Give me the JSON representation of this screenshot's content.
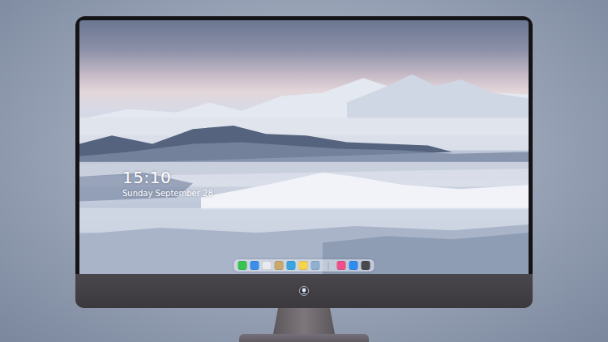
{
  "lock_screen": {
    "time": "15:10",
    "date": "Sunday September 28"
  },
  "dock": {
    "items": [
      {
        "kind": "app",
        "color": "#3ac44f"
      },
      {
        "kind": "app",
        "color": "#3b8fe8"
      },
      {
        "kind": "app",
        "color": "#e8eaee"
      },
      {
        "kind": "app",
        "color": "#c9a86a"
      },
      {
        "kind": "app",
        "color": "#3aa4e0"
      },
      {
        "kind": "app",
        "color": "#f6d34a"
      },
      {
        "kind": "app",
        "color": "#8fb0d0"
      },
      {
        "kind": "separator",
        "color": "#9aa3b5"
      },
      {
        "kind": "app",
        "color": "#f04f8a"
      },
      {
        "kind": "app",
        "color": "#2f8cf0"
      },
      {
        "kind": "app",
        "color": "#4a4a4e"
      }
    ]
  }
}
